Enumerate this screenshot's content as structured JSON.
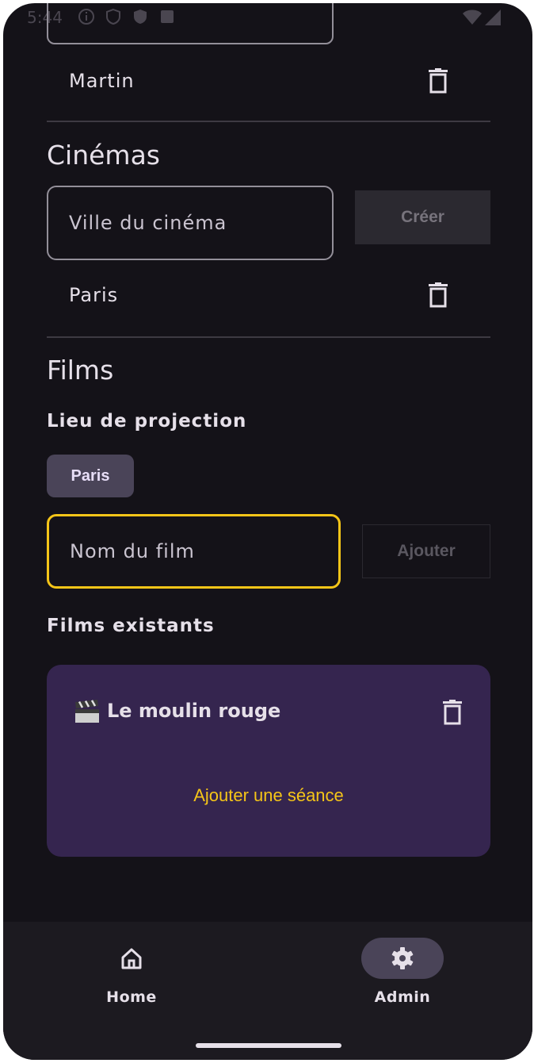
{
  "status_bar": {
    "time": "5:44"
  },
  "users": {
    "items": [
      {
        "name": "Martin"
      }
    ]
  },
  "cinemas": {
    "title": "Cinémas",
    "input_placeholder": "Ville du cinéma",
    "create_label": "Créer",
    "items": [
      {
        "name": "Paris"
      }
    ]
  },
  "films": {
    "title": "Films",
    "venue_label": "Lieu de projection",
    "venue_chip": "Paris",
    "input_placeholder": "Nom du film",
    "add_label": "Ajouter",
    "existing_label": "Films existants",
    "items": [
      {
        "title": "Le moulin rouge",
        "action": "Ajouter une séance"
      }
    ]
  },
  "nav": {
    "items": [
      {
        "label": "Home",
        "icon": "home-icon",
        "active": false
      },
      {
        "label": "Admin",
        "icon": "gear-icon",
        "active": true
      }
    ]
  },
  "colors": {
    "background": "#141218",
    "accent": "#f5c518",
    "card": "#35254f",
    "chip": "#4a4458"
  }
}
